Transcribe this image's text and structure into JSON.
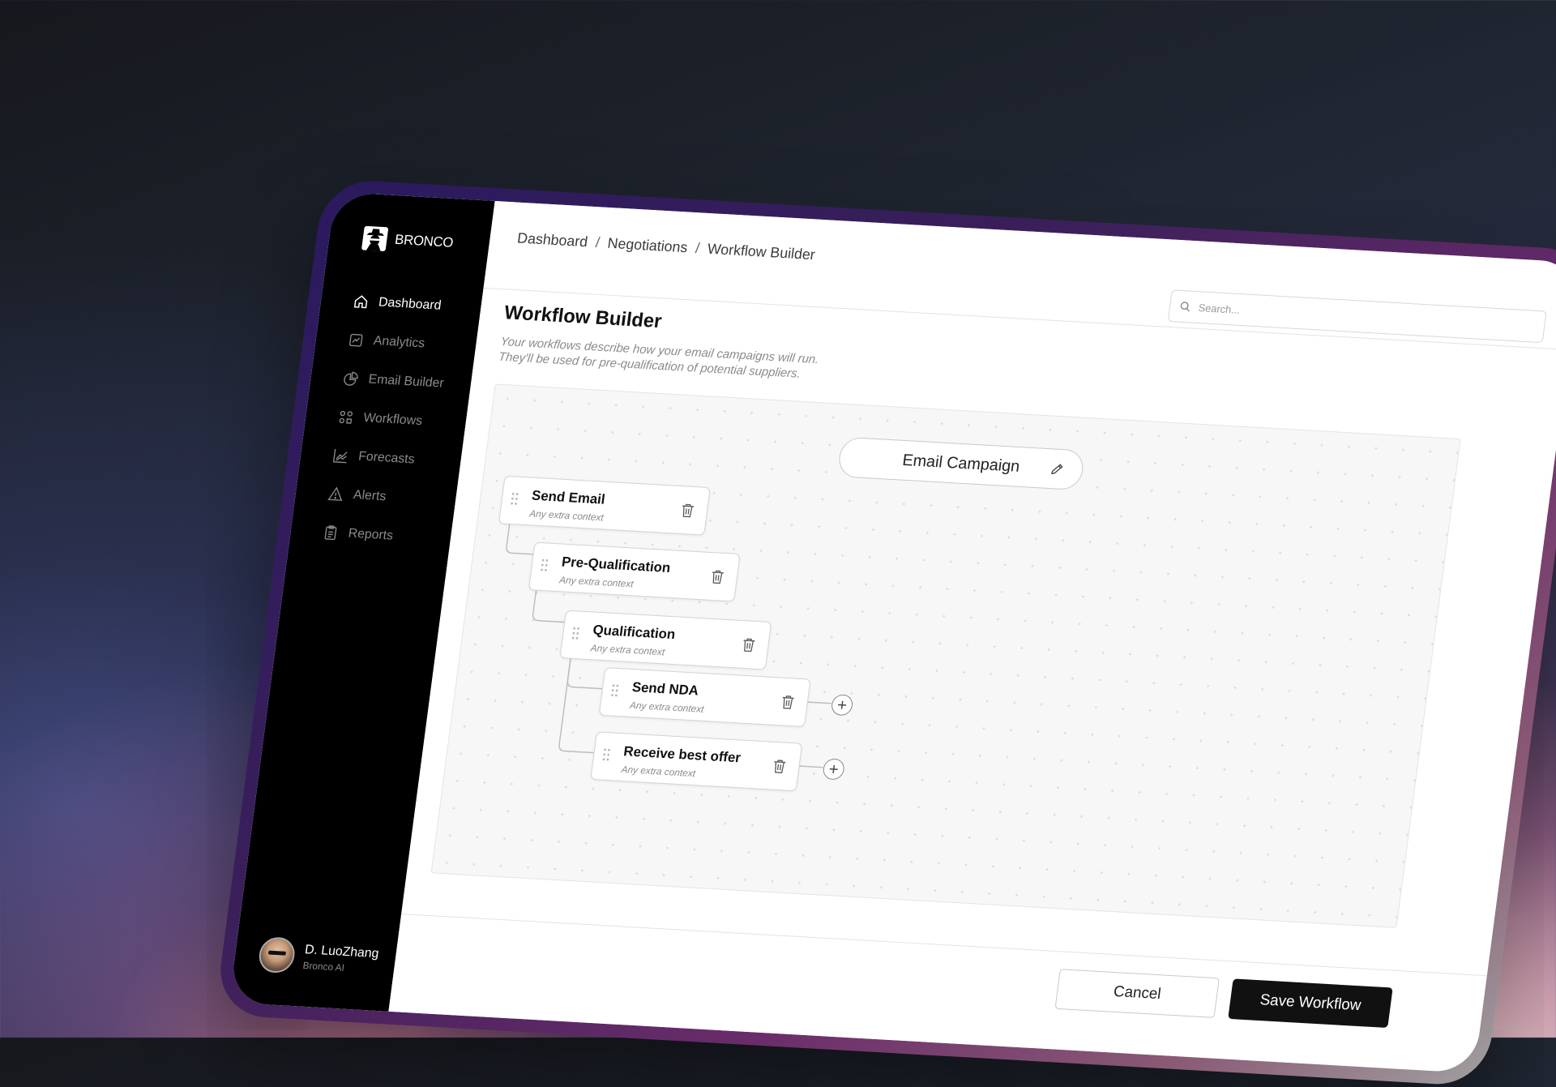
{
  "brand": {
    "name": "BRONCO"
  },
  "sidebar": {
    "items": [
      {
        "label": "Dashboard",
        "icon": "home-icon",
        "active": true
      },
      {
        "label": "Analytics",
        "icon": "analytics-icon",
        "active": false
      },
      {
        "label": "Email Builder",
        "icon": "pie-chart-icon",
        "active": false
      },
      {
        "label": "Workflows",
        "icon": "workflow-icon",
        "active": false
      },
      {
        "label": "Forecasts",
        "icon": "line-chart-icon",
        "active": false
      },
      {
        "label": "Alerts",
        "icon": "alert-icon",
        "active": false
      },
      {
        "label": "Reports",
        "icon": "clipboard-icon",
        "active": false
      }
    ],
    "user": {
      "name": "D. LuoZhang",
      "org": "Bronco AI"
    }
  },
  "breadcrumb": [
    "Dashboard",
    "Negotiations",
    "Workflow Builder"
  ],
  "search": {
    "placeholder": "Search..."
  },
  "page": {
    "title": "Workflow Builder",
    "description_line1": "Your workflows describe how your email campaigns will run.",
    "description_line2": "They'll be used for pre-qualification of potential suppliers."
  },
  "workflow": {
    "campaign_title": "Email Campaign",
    "nodes": [
      {
        "title": "Send Email",
        "subtitle": "Any extra context"
      },
      {
        "title": "Pre-Qualification",
        "subtitle": "Any extra context"
      },
      {
        "title": "Qualification",
        "subtitle": "Any extra context"
      },
      {
        "title": "Send NDA",
        "subtitle": "Any extra context"
      },
      {
        "title": "Receive best offer",
        "subtitle": "Any extra context"
      }
    ]
  },
  "actions": {
    "cancel_label": "Cancel",
    "save_label": "Save Workflow"
  },
  "colors": {
    "sidebar_bg": "#000000",
    "primary_button": "#111111",
    "canvas_bg": "#f7f7f7"
  }
}
